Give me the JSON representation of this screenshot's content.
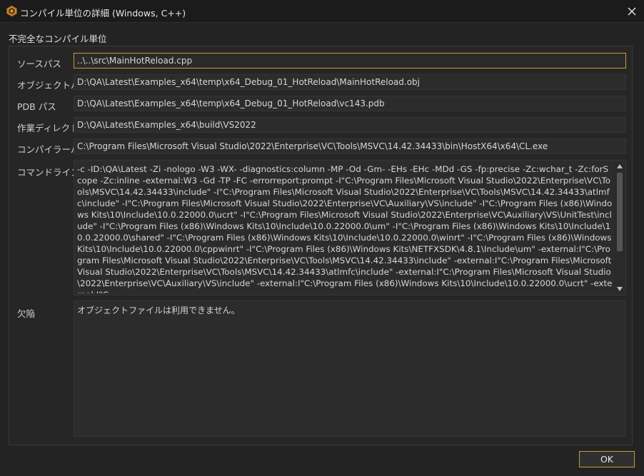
{
  "window": {
    "title": "コンパイル単位の詳細 (Windows, C++)",
    "close_glyph": "✕"
  },
  "section": {
    "title": "不完全なコンパイル単位"
  },
  "fields": [
    {
      "label": "ソースパス",
      "value": "..\\..\\src\\MainHotReload.cpp"
    },
    {
      "label": "オブジェクトパス",
      "value": "D:\\QA\\Latest\\Examples_x64\\temp\\x64_Debug_01_HotReload\\MainHotReload.obj"
    },
    {
      "label": "PDB パス",
      "value": "D:\\QA\\Latest\\Examples_x64\\temp\\x64_Debug_01_HotReload\\vc143.pdb"
    },
    {
      "label": "作業ディレクトリ",
      "value": "D:\\QA\\Latest\\Examples_x64\\build\\VS2022"
    },
    {
      "label": "コンパイラーパス",
      "value": "C:\\Program Files\\Microsoft Visual Studio\\2022\\Enterprise\\VC\\Tools\\MSVC\\14.42.34433\\bin\\HostX64\\x64\\CL.exe"
    }
  ],
  "command_line": {
    "label": "コマンドライン",
    "value": "-c -ID:\\QA\\Latest -Zi -nologo -W3 -WX- -diagnostics:column -MP -Od -Gm- -EHs -EHc -MDd -GS -fp:precise -Zc:wchar_t -Zc:forScope -Zc:inline -external:W3 -Gd -TP -FC -errorreport:prompt -I\"C:\\Program Files\\Microsoft Visual Studio\\2022\\Enterprise\\VC\\Tools\\MSVC\\14.42.34433\\include\" -I\"C:\\Program Files\\Microsoft Visual Studio\\2022\\Enterprise\\VC\\Tools\\MSVC\\14.42.34433\\atlmfc\\include\" -I\"C:\\Program Files\\Microsoft Visual Studio\\2022\\Enterprise\\VC\\Auxiliary\\VS\\include\" -I\"C:\\Program Files (x86)\\Windows Kits\\10\\Include\\10.0.22000.0\\ucrt\" -I\"C:\\Program Files\\Microsoft Visual Studio\\2022\\Enterprise\\VC\\Auxiliary\\VS\\UnitTest\\include\" -I\"C:\\Program Files (x86)\\Windows Kits\\10\\Include\\10.0.22000.0\\um\" -I\"C:\\Program Files (x86)\\Windows Kits\\10\\Include\\10.0.22000.0\\shared\" -I\"C:\\Program Files (x86)\\Windows Kits\\10\\Include\\10.0.22000.0\\winrt\" -I\"C:\\Program Files (x86)\\Windows Kits\\10\\Include\\10.0.22000.0\\cppwinrt\" -I\"C:\\Program Files (x86)\\Windows Kits\\NETFXSDK\\4.8.1\\Include\\um\" -external:I\"C:\\Program Files\\Microsoft Visual Studio\\2022\\Enterprise\\VC\\Tools\\MSVC\\14.42.34433\\include\" -external:I\"C:\\Program Files\\Microsoft Visual Studio\\2022\\Enterprise\\VC\\Tools\\MSVC\\14.42.34433\\atlmfc\\include\" -external:I\"C:\\Program Files\\Microsoft Visual Studio\\2022\\Enterprise\\VC\\Auxiliary\\VS\\include\" -external:I\"C:\\Program Files (x86)\\Windows Kits\\10\\Include\\10.0.22000.0\\ucrt\" -external:I\"C:"
  },
  "defect": {
    "label": "欠陥",
    "value": "オブジェクトファイルは利用できません。"
  },
  "buttons": {
    "ok": "OK"
  },
  "colors": {
    "accent": "#c99a3a",
    "background": "#232323",
    "field": "#2c2c2c"
  }
}
